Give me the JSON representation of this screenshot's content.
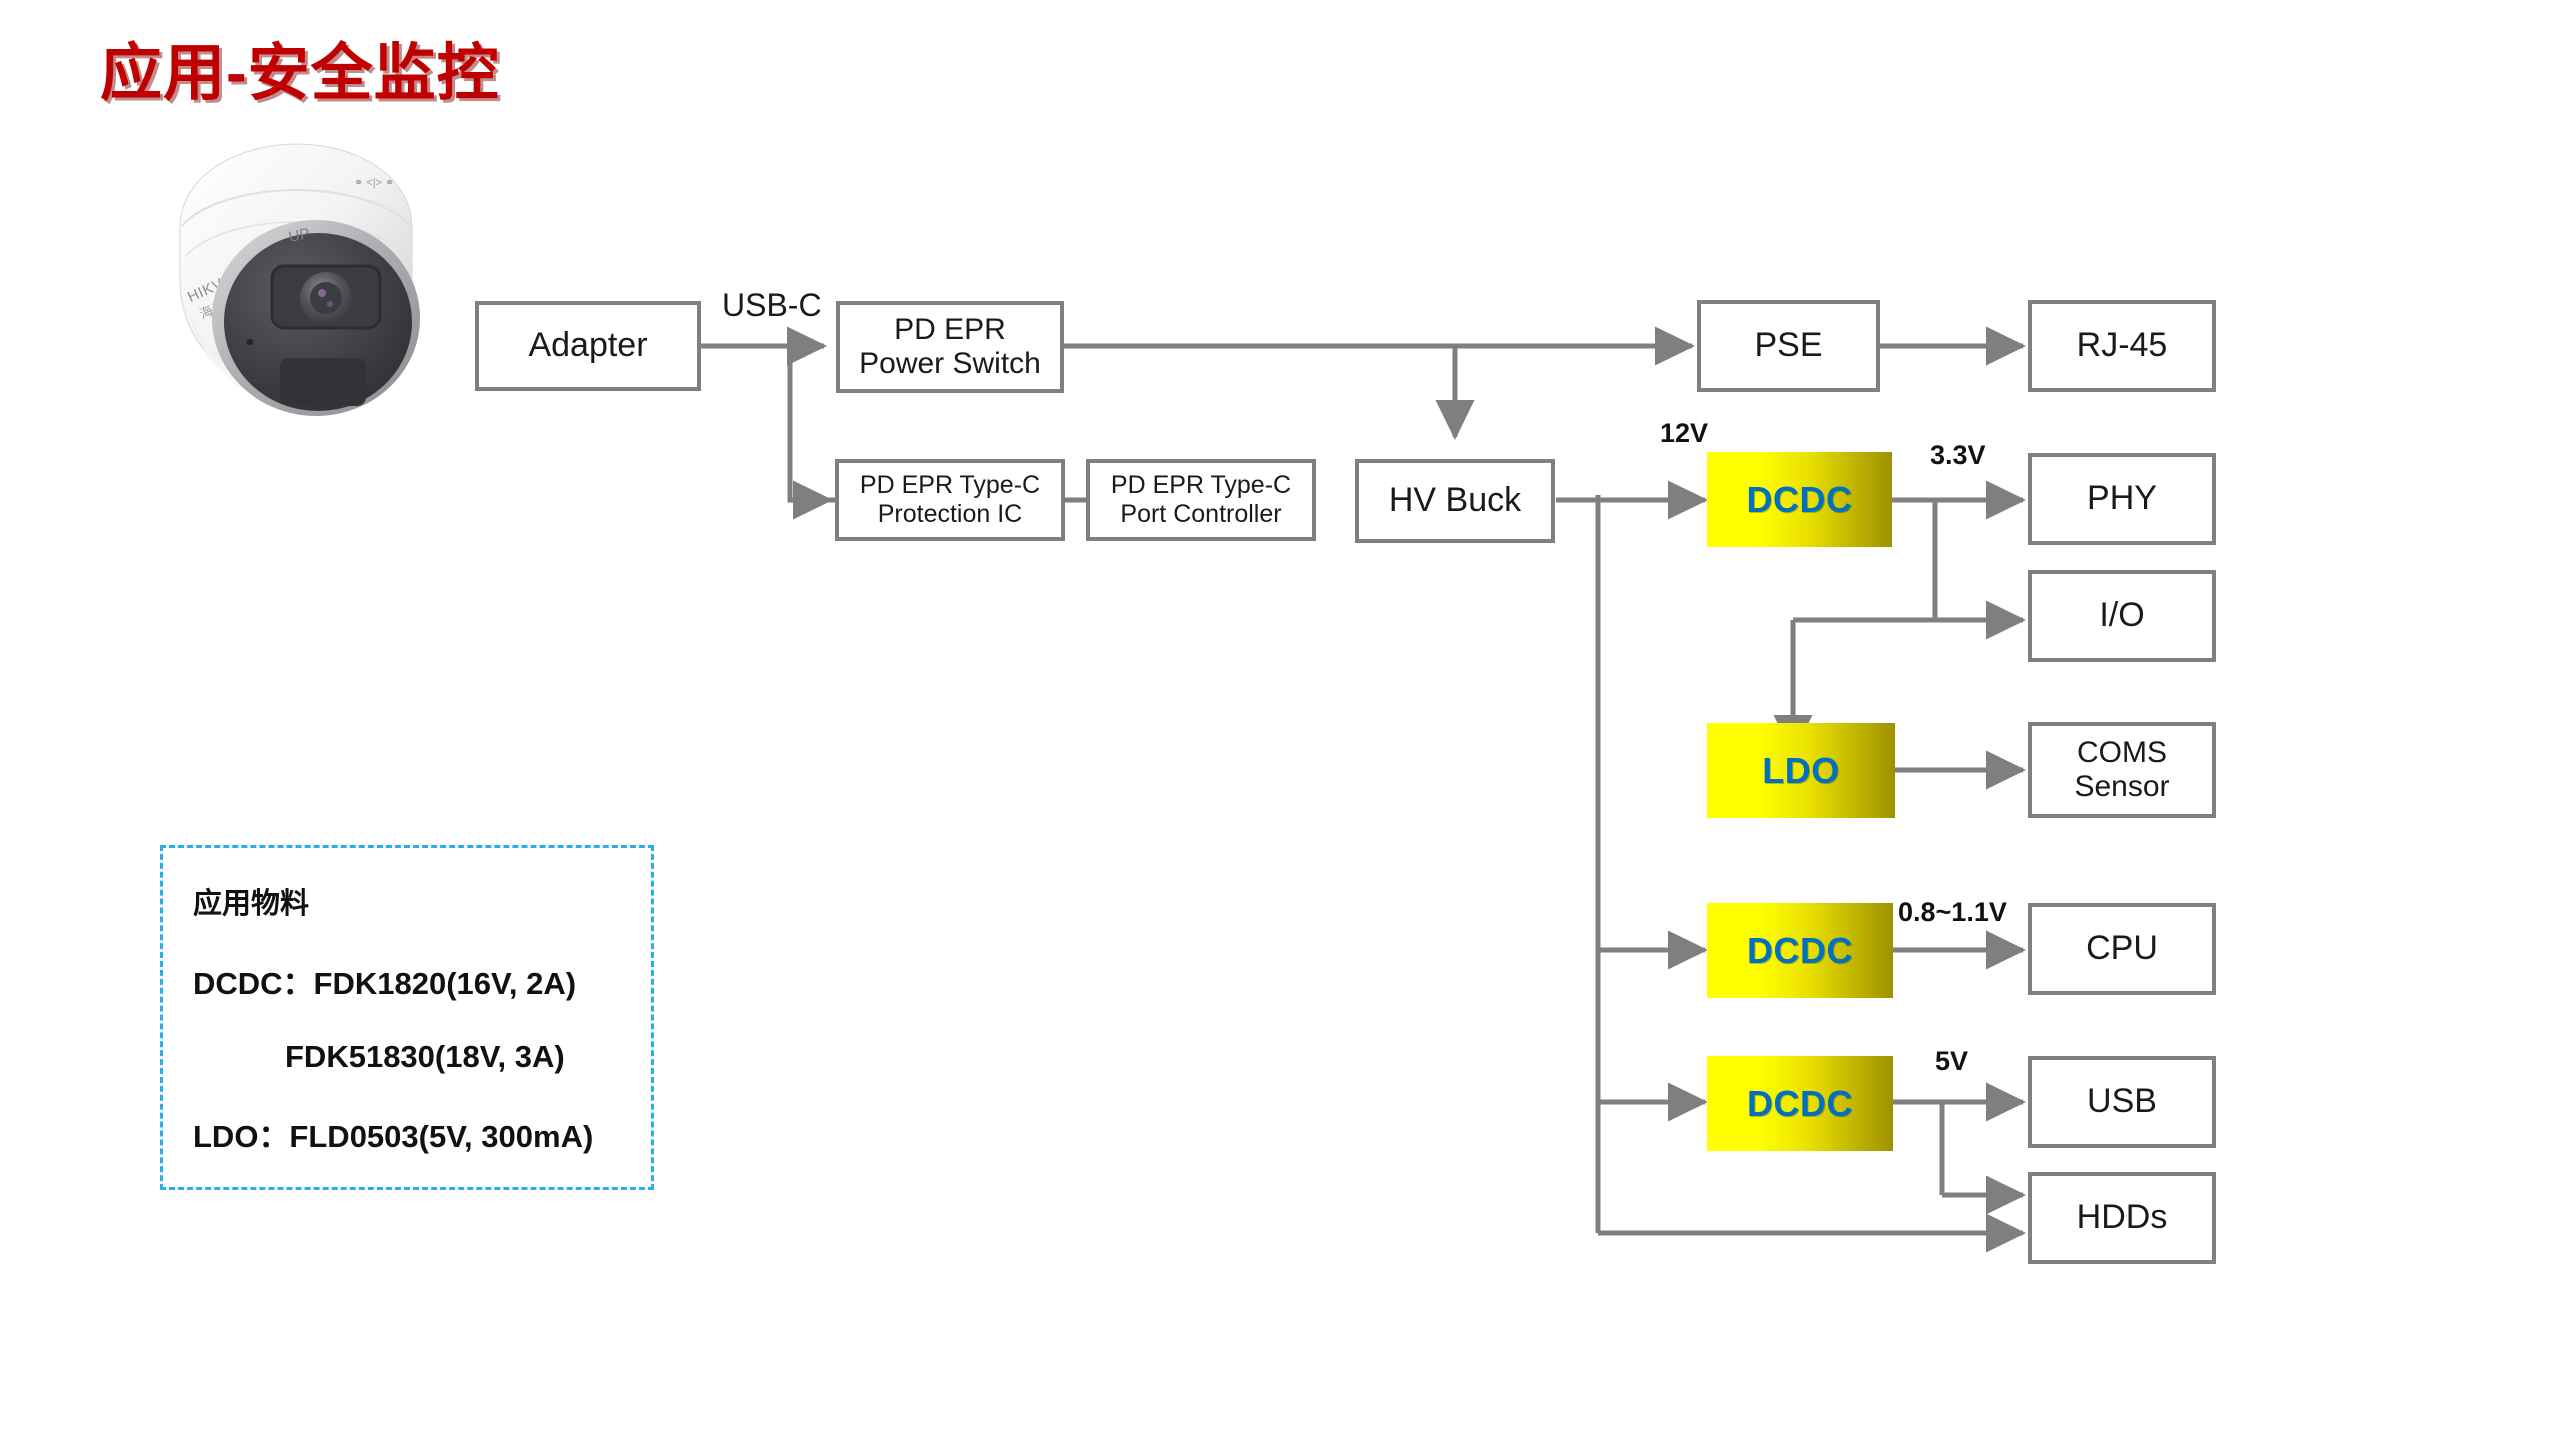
{
  "page": {
    "title": "应用-安全监控"
  },
  "camera": {
    "name": "dome-security-camera",
    "brand": "HIKVISION",
    "brand_cn": "海康威视",
    "up_marker": "UP"
  },
  "diagram": {
    "edge_labels": {
      "usb_c": "USB-C",
      "v12": "12V",
      "v33": "3.3V",
      "v_cpu": "0.8~1.1V",
      "v5": "5V"
    },
    "blocks": [
      {
        "id": "adapter",
        "label": "Adapter",
        "kind": "plain"
      },
      {
        "id": "pd-power-switch",
        "label": "PD EPR\nPower Switch",
        "kind": "plain"
      },
      {
        "id": "pd-protection",
        "label": "PD EPR Type-C\nProtection IC",
        "kind": "plain"
      },
      {
        "id": "pd-port-ctrl",
        "label": "PD EPR Type-C\nPort Controller",
        "kind": "plain"
      },
      {
        "id": "hv-buck",
        "label": "HV Buck",
        "kind": "plain"
      },
      {
        "id": "pse",
        "label": "PSE",
        "kind": "plain"
      },
      {
        "id": "rj45",
        "label": "RJ-45",
        "kind": "plain"
      },
      {
        "id": "dcdc-33",
        "label": "DCDC",
        "kind": "power"
      },
      {
        "id": "phy",
        "label": "PHY",
        "kind": "plain"
      },
      {
        "id": "io",
        "label": "I/O",
        "kind": "plain"
      },
      {
        "id": "ldo",
        "label": "LDO",
        "kind": "power"
      },
      {
        "id": "coms-sensor",
        "label": "COMS\nSensor",
        "kind": "plain"
      },
      {
        "id": "dcdc-cpu",
        "label": "DCDC",
        "kind": "power"
      },
      {
        "id": "cpu",
        "label": "CPU",
        "kind": "plain"
      },
      {
        "id": "dcdc-5v",
        "label": "DCDC",
        "kind": "power"
      },
      {
        "id": "usb",
        "label": "USB",
        "kind": "plain"
      },
      {
        "id": "hdds",
        "label": "HDDs",
        "kind": "plain"
      }
    ]
  },
  "legend": {
    "title": "应用物料",
    "rows": [
      "DCDC：FDK1820(16V, 2A)",
      "FDK51830(18V, 3A)",
      "LDO：FLD0503(5V, 300mA)"
    ]
  },
  "colors": {
    "title_red": "#c00000",
    "block_border": "#808080",
    "power_yellow": "#ffff00",
    "power_label_blue": "#0070c0",
    "legend_dashed": "#2badea",
    "wire": "#7f7f7f"
  }
}
